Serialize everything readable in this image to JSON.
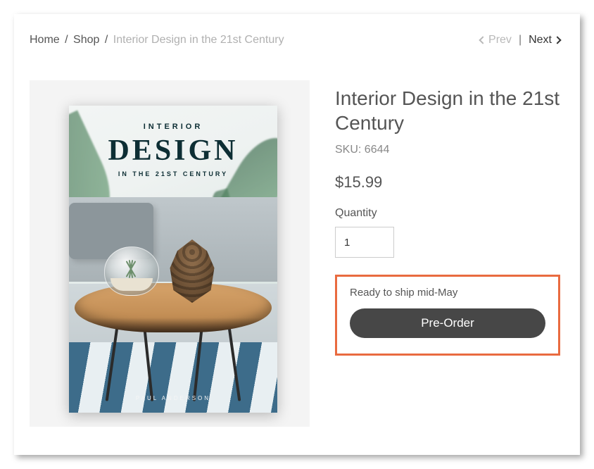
{
  "breadcrumb": {
    "home": "Home",
    "shop": "Shop",
    "current": "Interior Design in the 21st Century"
  },
  "nav": {
    "prev": "Prev",
    "next": "Next"
  },
  "cover": {
    "line1": "INTERIOR",
    "line2": "DESIGN",
    "line3": "IN THE 21ST CENTURY",
    "author": "PAUL ANDERSON"
  },
  "product": {
    "title": "Interior Design in the 21st Century",
    "sku_label": "SKU: 6644",
    "price": "$15.99",
    "quantity_label": "Quantity",
    "quantity_value": "1",
    "ship_text": "Ready to ship mid-May",
    "preorder_label": "Pre-Order"
  }
}
